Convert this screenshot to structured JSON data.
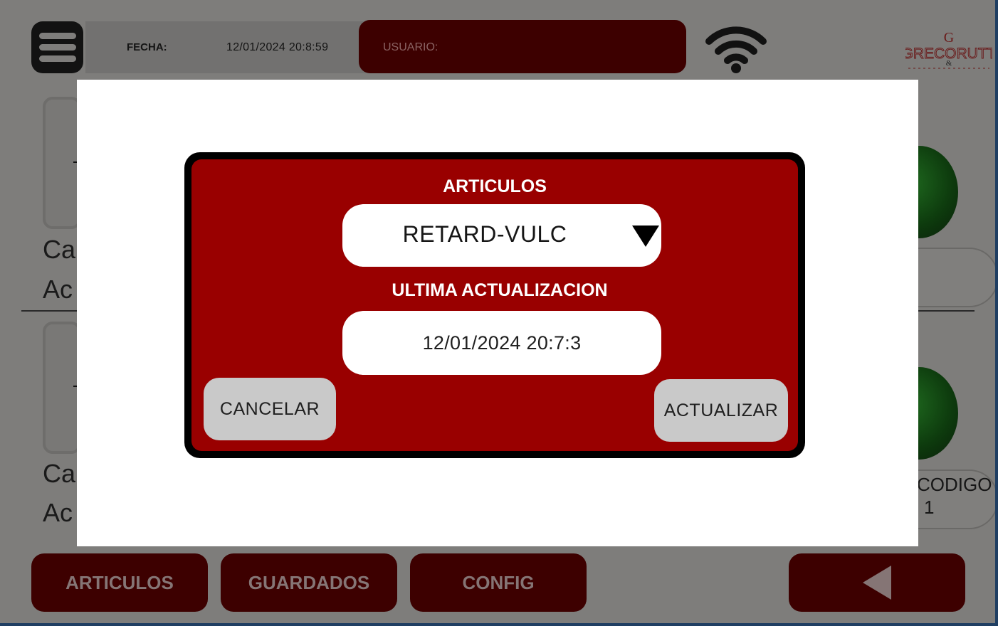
{
  "header": {
    "fecha_label": "FECHA:",
    "fecha_value": "12/01/2024 20:8:59",
    "usuario_label": "USUARIO:",
    "logo_text": "GRECORUTT"
  },
  "background": {
    "card_text_1": "Ca",
    "card_text_2": "Ac",
    "card_text_3": "Ca",
    "card_text_4": "Ac",
    "codigo_label": "CODIGO",
    "codigo_value": "1"
  },
  "nav": {
    "articulos": "ARTICULOS",
    "guardados": "GUARDADOS",
    "config": "CONFIG"
  },
  "dialog": {
    "title": "ARTICULOS",
    "selected_article": "RETARD-VULC",
    "update_label": "ULTIMA ACTUALIZACION",
    "update_value": "12/01/2024 20:7:3",
    "cancel_label": "CANCELAR",
    "update_button_label": "ACTUALIZAR"
  },
  "colors": {
    "dialog_bg": "#990000",
    "header_user_bg": "#3d0000",
    "overlay_bg": "#7e7d7b"
  },
  "icons": [
    "menu-icon",
    "wifi-icon",
    "back-arrow-icon",
    "dropdown-arrow-icon",
    "logo-icon"
  ]
}
